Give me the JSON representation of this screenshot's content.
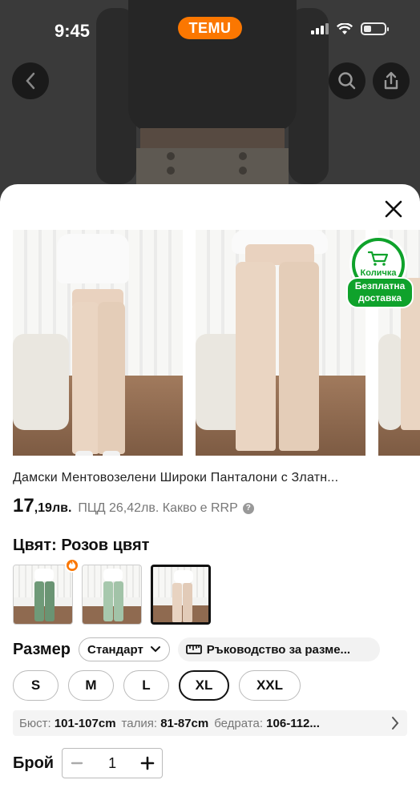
{
  "status_bar": {
    "time": "9:45",
    "brand": "TEMU"
  },
  "background": {
    "back_icon": "chevron-left-icon",
    "search_icon": "search-icon",
    "share_icon": "share-icon"
  },
  "sheet": {
    "close_icon": "close-icon",
    "cart_badge": {
      "cart_label": "Количка",
      "free_shipping": [
        "Безплатна",
        "доставка"
      ]
    },
    "product_title": "Дамски Ментовозелени Широки Панталони с Златн...",
    "price": {
      "integer": "17",
      "decimal": ",19лв.",
      "rrp": "ПЦД 26,42лв. Какво е RRP"
    },
    "color": {
      "label": "Цвят: Розов цвят"
    },
    "swatches": [
      {
        "name": "green",
        "color": "#6f9a78",
        "hot": true
      },
      {
        "name": "mint",
        "color": "#a7c8ad",
        "hot": false
      },
      {
        "name": "pink",
        "color": "#e8d3c1",
        "hot": false,
        "selected": true
      }
    ],
    "size": {
      "label": "Размер",
      "standard": "Стандарт",
      "guide": "Ръководство за разме...",
      "options": [
        "S",
        "M",
        "L",
        "XL",
        "XXL"
      ],
      "selected": "XL"
    },
    "measurements": {
      "bust_label": "Бюст:",
      "bust": "101-107cm",
      "waist_label": "талия:",
      "waist": "81-87cm",
      "hips_label": "бедрата:",
      "hips": "106-112..."
    },
    "quantity": {
      "label": "Брой",
      "value": "1"
    }
  }
}
